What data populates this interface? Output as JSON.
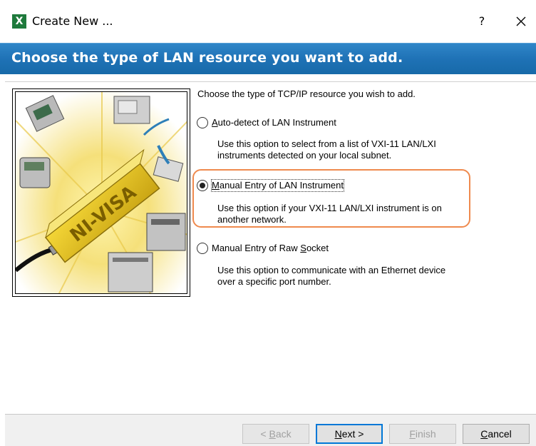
{
  "window": {
    "title": "Create New ...",
    "help_label": "?",
    "app_icon_glyph": "X",
    "app_icon_color": "#1e7a3c"
  },
  "banner": {
    "heading": "Choose the type of LAN resource you want to add.",
    "color": "#1f72b6"
  },
  "content": {
    "intro": "Choose the type of TCP/IP resource you wish to add.",
    "illustration_text": "NI-VISA",
    "options": [
      {
        "label": "Auto-detect of LAN Instrument",
        "mnemonic_index": 0,
        "description_lines": [
          "Use this option to select from a list of VXI-11 LAN/LXI",
          "instruments detected on your local subnet."
        ],
        "selected": false
      },
      {
        "label": "Manual Entry of LAN Instrument",
        "mnemonic_index": 0,
        "description_lines": [
          "Use this option if your VXI-11 LAN/LXI instrument is on",
          "another network."
        ],
        "selected": true
      },
      {
        "label": "Manual Entry of Raw Socket",
        "mnemonic_index": 20,
        "description_lines": [
          "Use this option to communicate with an Ethernet device",
          "over a specific port number."
        ],
        "selected": false
      }
    ],
    "highlight_color": "#ef8a4e"
  },
  "buttons": {
    "back": "< Back",
    "next": "Next >",
    "finish": "Finish",
    "cancel": "Cancel"
  }
}
